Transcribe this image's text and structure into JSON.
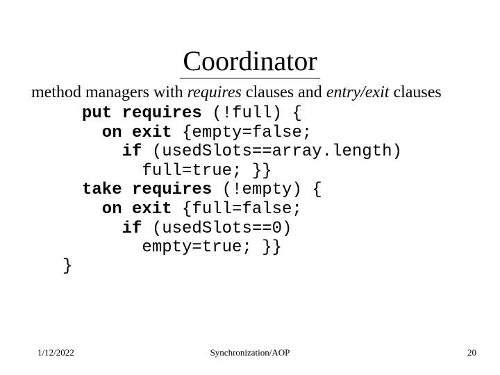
{
  "title": "Coordinator",
  "subtitle": {
    "p1": "method managers with ",
    "it1": "requires",
    "p2": " clauses and ",
    "it2": "entry/exit",
    "p3": " clauses"
  },
  "code": {
    "l1a": "put requires",
    "l1b": " (!full) {",
    "l2a": "  on exit",
    "l2b": " {empty=false;",
    "l3a": "    if",
    "l3b": " (usedSlots==array.length)",
    "l4": "      full=true; }}",
    "l5a": "take requires",
    "l5b": " (!empty) {",
    "l6a": "  on exit",
    "l6b": " {full=false;",
    "l7a": "    if",
    "l7b": " (usedSlots==0)",
    "l8": "      empty=true; }}",
    "closebrace": "}"
  },
  "footer": {
    "date": "1/12/2022",
    "center": "Synchronization/AOP",
    "page": "20"
  }
}
